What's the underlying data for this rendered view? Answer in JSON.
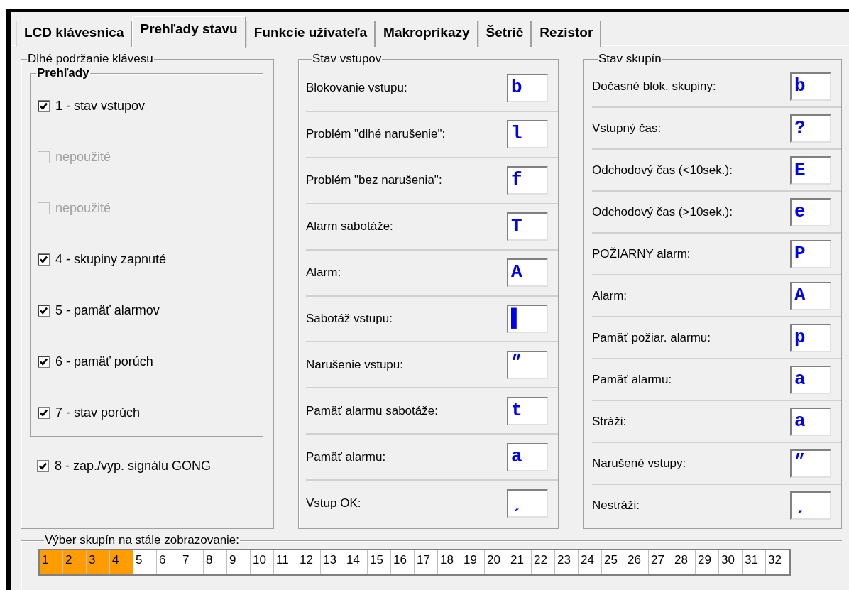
{
  "tabs": [
    {
      "label": "LCD klávesnica",
      "selected": false
    },
    {
      "label": "Prehľady stavu",
      "selected": true
    },
    {
      "label": "Funkcie užívateľa",
      "selected": false
    },
    {
      "label": "Makropríkazy",
      "selected": false
    },
    {
      "label": "Šetrič",
      "selected": false
    },
    {
      "label": "Rezistor",
      "selected": false
    }
  ],
  "long_press": {
    "title": "Dlhé podržanie klávesu",
    "overviews": {
      "title": "Prehľady",
      "items": [
        {
          "label": "1 - stav vstupov",
          "checked": true,
          "disabled": false
        },
        {
          "label": "nepoužité",
          "checked": false,
          "disabled": true
        },
        {
          "label": "nepoužité",
          "checked": false,
          "disabled": true
        },
        {
          "label": "4 - skupiny zapnuté",
          "checked": true,
          "disabled": false
        },
        {
          "label": "5 - pamäť alarmov",
          "checked": true,
          "disabled": false
        },
        {
          "label": "6 - pamäť porúch",
          "checked": true,
          "disabled": false
        },
        {
          "label": "7 - stav porúch",
          "checked": true,
          "disabled": false
        }
      ]
    },
    "gong": {
      "label": "8 - zap./vyp. signálu GONG",
      "checked": true,
      "disabled": false
    }
  },
  "zone_status": {
    "title": "Stav vstupov",
    "rows": [
      {
        "label": "Blokovanie vstupu:",
        "value": "b"
      },
      {
        "label": "Problém \"dlhé narušenie\":",
        "value": "l"
      },
      {
        "label": "Problém \"bez narušenia\":",
        "value": "f"
      },
      {
        "label": "Alarm sabotáže:",
        "value": "T"
      },
      {
        "label": "Alarm:",
        "value": "A"
      },
      {
        "label": "Sabotáž vstupu:",
        "value": "▌"
      },
      {
        "label": "Narušenie vstupu:",
        "value": "״"
      },
      {
        "label": "Pamäť alarmu sabotáže:",
        "value": "t"
      },
      {
        "label": "Pamäť alarmu:",
        "value": "a"
      },
      {
        "label": "Vstup OK:",
        "value": "ˏ"
      }
    ]
  },
  "partition_status": {
    "title": "Stav skupín",
    "rows": [
      {
        "label": "Dočasné blok. skupiny:",
        "value": "b"
      },
      {
        "label": "Vstupný čas:",
        "value": "?"
      },
      {
        "label": "Odchodový čas (<10sek.):",
        "value": "E"
      },
      {
        "label": "Odchodový čas (>10sek.):",
        "value": "e"
      },
      {
        "label": "POŽIARNY alarm:",
        "value": "P"
      },
      {
        "label": "Alarm:",
        "value": "A"
      },
      {
        "label": "Pamäť požiar. alarmu:",
        "value": "p"
      },
      {
        "label": "Pamäť alarmu:",
        "value": "a"
      },
      {
        "label": "Stráži:",
        "value": "a"
      },
      {
        "label": "Narušené vstupy:",
        "value": "״"
      },
      {
        "label": "Nestráži:",
        "value": "ˏ"
      }
    ]
  },
  "display_selection": {
    "title": "Výber skupín na stále zobrazovanie:",
    "cells": [
      {
        "label": "1",
        "selected": true
      },
      {
        "label": "2",
        "selected": true
      },
      {
        "label": "3",
        "selected": true
      },
      {
        "label": "4",
        "selected": true
      },
      {
        "label": "5",
        "selected": false
      },
      {
        "label": "6",
        "selected": false
      },
      {
        "label": "7",
        "selected": false
      },
      {
        "label": "8",
        "selected": false
      },
      {
        "label": "9",
        "selected": false
      },
      {
        "label": "10",
        "selected": false
      },
      {
        "label": "11",
        "selected": false
      },
      {
        "label": "12",
        "selected": false
      },
      {
        "label": "13",
        "selected": false
      },
      {
        "label": "14",
        "selected": false
      },
      {
        "label": "15",
        "selected": false
      },
      {
        "label": "16",
        "selected": false
      },
      {
        "label": "17",
        "selected": false
      },
      {
        "label": "18",
        "selected": false
      },
      {
        "label": "19",
        "selected": false
      },
      {
        "label": "20",
        "selected": false
      },
      {
        "label": "21",
        "selected": false
      },
      {
        "label": "22",
        "selected": false
      },
      {
        "label": "23",
        "selected": false
      },
      {
        "label": "24",
        "selected": false
      },
      {
        "label": "25",
        "selected": false
      },
      {
        "label": "26",
        "selected": false
      },
      {
        "label": "27",
        "selected": false
      },
      {
        "label": "28",
        "selected": false
      },
      {
        "label": "29",
        "selected": false
      },
      {
        "label": "30",
        "selected": false
      },
      {
        "label": "31",
        "selected": false
      },
      {
        "label": "32",
        "selected": false
      }
    ]
  }
}
